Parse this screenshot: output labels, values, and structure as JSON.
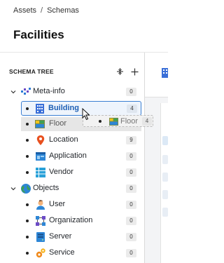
{
  "breadcrumb": {
    "items": [
      "Assets",
      "Schemas"
    ],
    "separator": "/"
  },
  "page_title": "Facilities",
  "tree": {
    "title": "SCHEMA TREE",
    "collapse_icon": "collapse-all-icon",
    "add_icon": "plus-icon",
    "groups": [
      {
        "label": "Meta-info",
        "count": "0",
        "icon": "meta-info-icon",
        "items": [
          {
            "label": "Building",
            "count": "4",
            "icon": "building-icon",
            "state": "selected"
          },
          {
            "label": "Floor",
            "count": "0",
            "icon": "floor-icon",
            "state": "dragging"
          },
          {
            "label": "Location",
            "count": "9",
            "icon": "location-pin-icon"
          },
          {
            "label": "Application",
            "count": "0",
            "icon": "application-icon"
          },
          {
            "label": "Vendor",
            "count": "0",
            "icon": "vendor-icon"
          }
        ]
      },
      {
        "label": "Objects",
        "count": "0",
        "icon": "globe-icon",
        "items": [
          {
            "label": "User",
            "count": "0",
            "icon": "user-icon"
          },
          {
            "label": "Organization",
            "count": "0",
            "icon": "organization-icon"
          },
          {
            "label": "Server",
            "count": "0",
            "icon": "server-icon"
          },
          {
            "label": "Service",
            "count": "0",
            "icon": "service-icon"
          }
        ]
      }
    ]
  },
  "drag_ghost": {
    "label": "Floor",
    "count": "4",
    "icon": "floor-icon"
  },
  "colors": {
    "accent": "#3b7fd2",
    "selected_bg": "#eef4fc",
    "badge_bg": "#ebebeb"
  }
}
